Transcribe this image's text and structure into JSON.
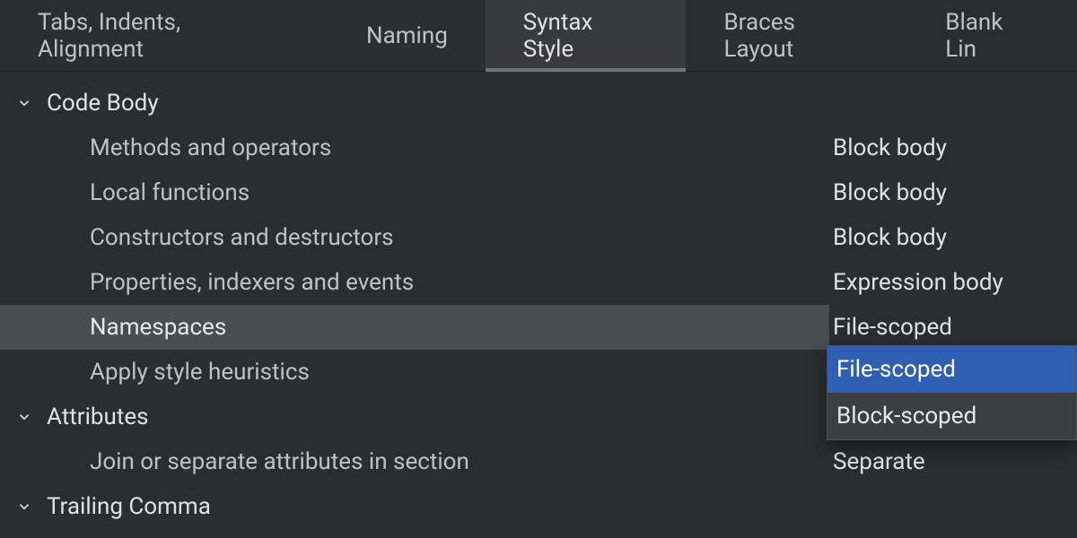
{
  "tabs": {
    "t0": "Tabs, Indents, Alignment",
    "t1": "Naming",
    "t2": "Syntax Style",
    "t3": "Braces Layout",
    "t4": "Blank Lin"
  },
  "groups": {
    "code_body": {
      "label": "Code Body",
      "items": {
        "methods": {
          "label": "Methods and operators",
          "value": "Block body"
        },
        "local_fns": {
          "label": "Local functions",
          "value": "Block body"
        },
        "ctors": {
          "label": "Constructors and destructors",
          "value": "Block body"
        },
        "props": {
          "label": "Properties, indexers and events",
          "value": "Expression body"
        },
        "namespaces": {
          "label": "Namespaces",
          "value": "File-scoped"
        },
        "heuristics": {
          "label": "Apply style heuristics",
          "value": ""
        }
      }
    },
    "attributes": {
      "label": "Attributes",
      "items": {
        "join": {
          "label": "Join or separate attributes in section",
          "value": "Separate"
        }
      }
    },
    "trailing_comma": {
      "label": "Trailing Comma"
    }
  },
  "dropdown": {
    "opt0": "File-scoped",
    "opt1": "Block-scoped"
  }
}
